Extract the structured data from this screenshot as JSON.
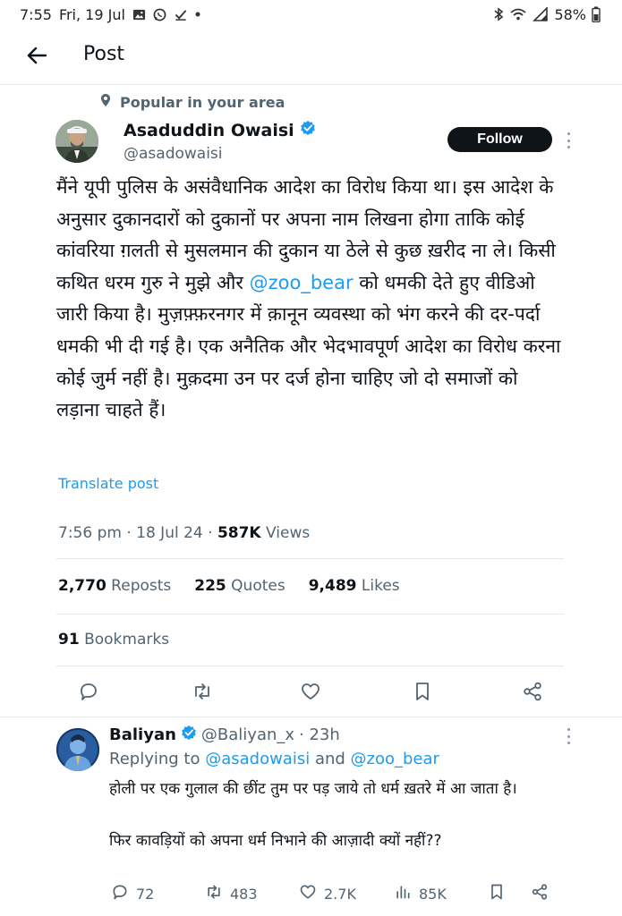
{
  "status_bar": {
    "time": "7:55",
    "date": "Fri, 19 Jul",
    "battery": "58%"
  },
  "header": {
    "title": "Post"
  },
  "post": {
    "context_label": "Popular in your area",
    "author_name": "Asaduddin Owaisi",
    "author_handle": "@asadowaisi",
    "follow_label": "Follow",
    "text_part1": "मैंने यूपी पुलिस के असंवैधानिक आदेश का विरोध किया था। इस आदेश के अनुसार दुकानदारों को दुकानों पर अपना नाम लिखना होगा ताकि कोई कांवरिया ग़लती से मुसलमान की दुकान या ठेले से कुछ ख़रीद ना ले। किसी कथित धरम गुरु ने मुझे और ",
    "text_mention": "@zoo_bear",
    "text_part2": "  को धमकी देते हुए वीडिओ जारी किया है। मुज़फ़्फ़रनगर में क़ानून व्यवस्था को भंग करने की दर-पर्दा धमकी भी दी गई है। एक अनैतिक और भेदभावपूर्ण आदेश का विरोध करना कोई जुर्म नहीं है। मुक़दमा उन पर दर्ज होना चाहिए जो दो समाजों को लड़ाना चाहते हैं।",
    "translate_label": "Translate post",
    "timestamp": "7:56 pm · 18 Jul 24 · ",
    "views_count": "587K",
    "views_label": " Views",
    "reposts_count": "2,770",
    "reposts_label": " Reposts",
    "quotes_count": "225",
    "quotes_label": " Quotes",
    "likes_count": "9,489",
    "likes_label": " Likes",
    "bookmarks_count": "91",
    "bookmarks_label": " Bookmarks",
    "icons": [
      "reply-icon",
      "repost-icon",
      "like-icon",
      "bookmark-icon",
      "share-icon"
    ]
  },
  "reply": {
    "author_name": "Baliyan",
    "author_handle": "@Baliyan_x",
    "time": "· 23h",
    "replying_prefix": "Replying to ",
    "replying_mention1": "@asadowaisi",
    "replying_and": " and ",
    "replying_mention2": "@zoo_bear",
    "text_line1": "होली पर एक गुलाल की छींट तुम पर पड़ जाये तो  धर्म ख़तरे में आ जाता है।",
    "text_line2": "फिर कावड़ियों को अपना धर्म निभाने की आज़ादी क्यों नहीं??",
    "reply_count": "72",
    "repost_count": "483",
    "like_count": "2.7K",
    "views_count": "85K"
  },
  "colors": {
    "accent": "#1d9bf0",
    "text_primary": "#0f1419",
    "text_secondary": "#536471",
    "divider": "#e7e7e7",
    "follow_bg": "#0f1419"
  }
}
